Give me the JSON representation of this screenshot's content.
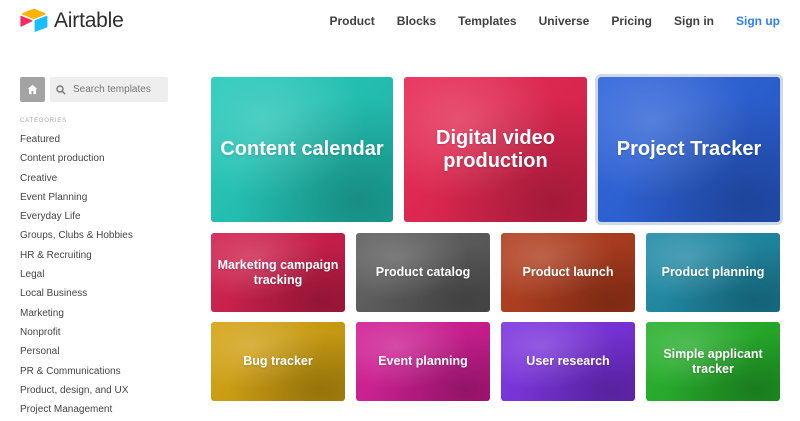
{
  "header": {
    "logo_text": "Airtable",
    "nav": [
      {
        "label": "Product"
      },
      {
        "label": "Blocks"
      },
      {
        "label": "Templates"
      },
      {
        "label": "Universe"
      },
      {
        "label": "Pricing"
      },
      {
        "label": "Sign in"
      },
      {
        "label": "Sign up"
      }
    ]
  },
  "sidebar": {
    "search_placeholder": "Search templates",
    "categories_heading": "CATEGORIES",
    "categories": [
      "Featured",
      "Content production",
      "Creative",
      "Event Planning",
      "Everyday Life",
      "Groups, Clubs & Hobbies",
      "HR & Recruiting",
      "Legal",
      "Local Business",
      "Marketing",
      "Nonprofit",
      "Personal",
      "PR & Communications",
      "Product, design, and UX",
      "Project Management"
    ]
  },
  "templates": {
    "featured": [
      {
        "label": "Content calendar",
        "color": "#1fc8b9"
      },
      {
        "label": "Digital video production",
        "color": "#e8234f"
      },
      {
        "label": "Project Tracker",
        "color": "#2860db"
      }
    ],
    "grid": [
      {
        "label": "Marketing campaign tracking",
        "color": "#d11b4a"
      },
      {
        "label": "Product catalog",
        "color": "#5b5b5b"
      },
      {
        "label": "Product launch",
        "color": "#b13a1a"
      },
      {
        "label": "Product planning",
        "color": "#1b8aa6"
      },
      {
        "label": "Bug tracker",
        "color": "#d4a20d"
      },
      {
        "label": "Event planning",
        "color": "#d11a93"
      },
      {
        "label": "User research",
        "color": "#7a2fe0"
      },
      {
        "label": "Simple applicant tracker",
        "color": "#22b027"
      }
    ]
  },
  "colors": {
    "accent": "#2d7ff9",
    "logo_yellow": "#fcb400",
    "logo_red": "#f82b60",
    "logo_blue": "#18bfff"
  }
}
